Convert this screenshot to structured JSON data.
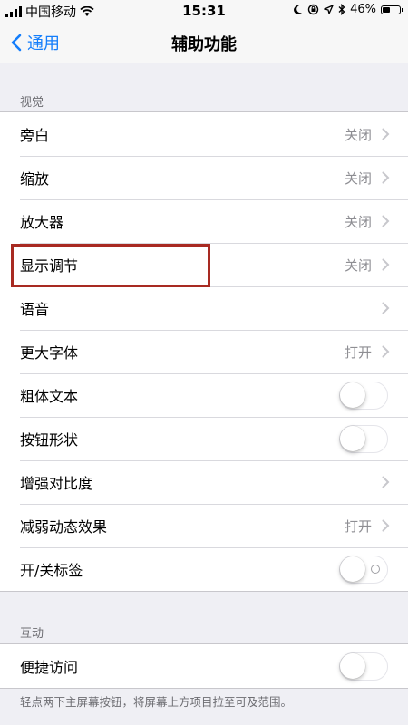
{
  "status_bar": {
    "carrier": "中国移动",
    "time": "15:31",
    "battery_percent": "46%",
    "battery_level": 0.46,
    "icons": [
      "signal-icon",
      "wifi-icon",
      "moon-icon",
      "lock-rotation-icon",
      "location-icon",
      "bluetooth-icon",
      "battery-icon"
    ]
  },
  "nav": {
    "back_label": "通用",
    "title": "辅助功能"
  },
  "sections": [
    {
      "header": "视觉",
      "rows": [
        {
          "label": "旁白",
          "value": "关闭"
        },
        {
          "label": "缩放",
          "value": "关闭"
        },
        {
          "label": "放大器",
          "value": "关闭"
        },
        {
          "label": "显示调节",
          "value": "关闭",
          "highlighted": true
        },
        {
          "label": "语音",
          "value": ""
        },
        {
          "label": "更大字体",
          "value": "打开"
        },
        {
          "label": "粗体文本",
          "toggle": false
        },
        {
          "label": "按钮形状",
          "toggle": false
        },
        {
          "label": "增强对比度",
          "value": ""
        },
        {
          "label": "减弱动态效果",
          "value": "打开"
        },
        {
          "label": "开/关标签",
          "toggle": false
        }
      ]
    },
    {
      "header": "互动",
      "rows": [
        {
          "label": "便捷访问",
          "toggle": false
        }
      ],
      "footer": "轻点两下主屏幕按钮，将屏幕上方项目拉至可及范围。"
    }
  ],
  "colors": {
    "accent": "#147efb",
    "background": "#efeff4",
    "highlight_box": "#a82a22"
  }
}
